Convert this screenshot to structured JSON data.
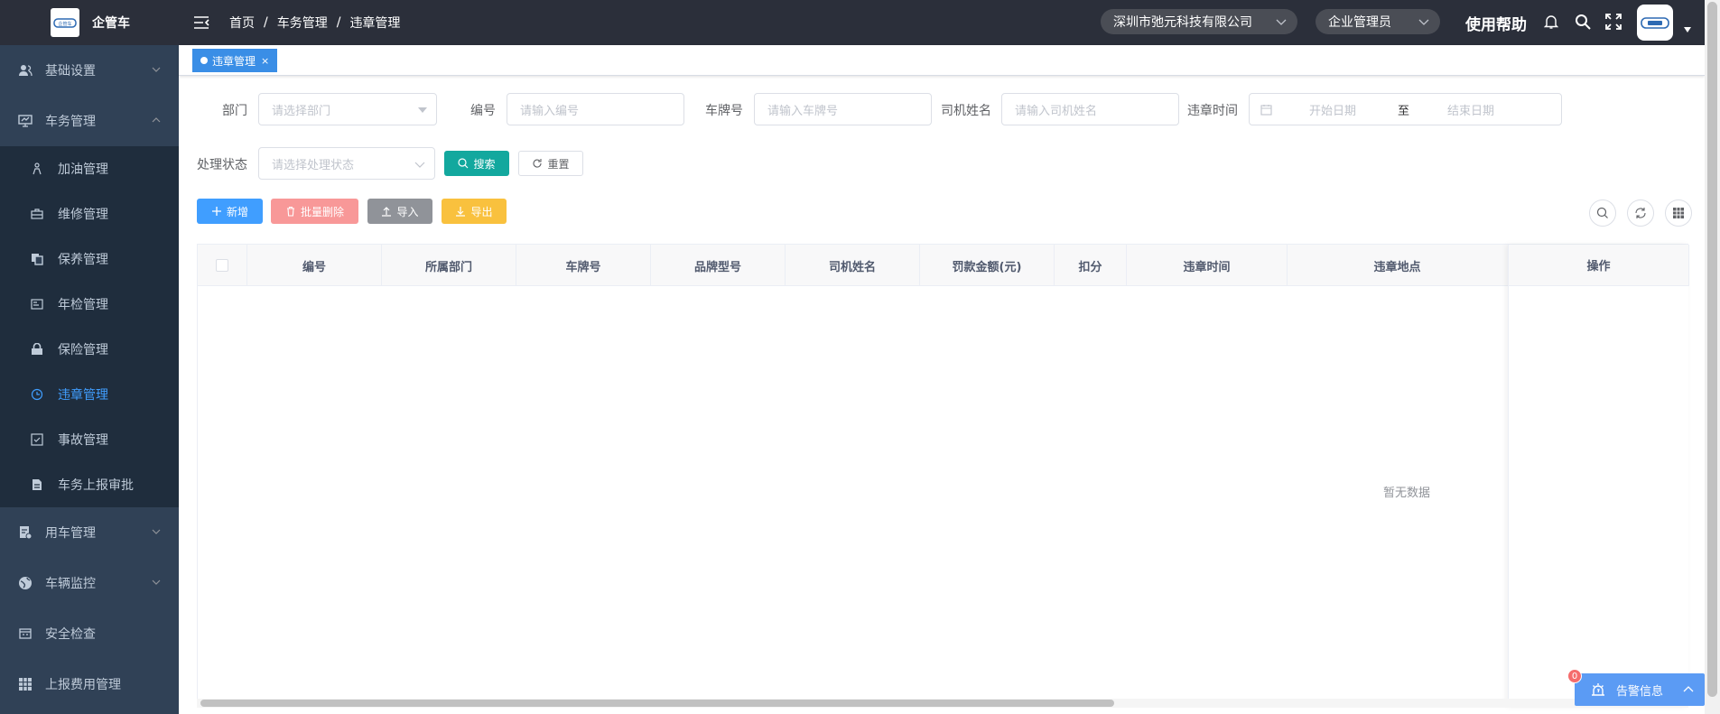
{
  "app": {
    "title": "企管车",
    "logo_text": "企管车"
  },
  "sidebar": {
    "groups": [
      {
        "label": "基础设置",
        "icon": "user-group-icon",
        "expanded": false
      },
      {
        "label": "车务管理",
        "icon": "monitor-icon",
        "expanded": true,
        "items": [
          {
            "label": "加油管理",
            "icon": "fuel-icon"
          },
          {
            "label": "维修管理",
            "icon": "toolbox-icon"
          },
          {
            "label": "保养管理",
            "icon": "copy-icon"
          },
          {
            "label": "年检管理",
            "icon": "card-icon"
          },
          {
            "label": "保险管理",
            "icon": "lock-icon"
          },
          {
            "label": "违章管理",
            "icon": "clock-icon",
            "active": true
          },
          {
            "label": "事故管理",
            "icon": "checkbox-icon"
          },
          {
            "label": "车务上报审批",
            "icon": "document-icon"
          }
        ]
      },
      {
        "label": "用车管理",
        "icon": "car-doc-icon",
        "expanded": false
      },
      {
        "label": "车辆监控",
        "icon": "globe-icon",
        "expanded": false
      },
      {
        "label": "安全检查",
        "icon": "calendar-icon"
      },
      {
        "label": "上报费用管理",
        "icon": "grid-icon"
      }
    ]
  },
  "navbar": {
    "breadcrumb": [
      "首页",
      "车务管理",
      "违章管理"
    ],
    "company": "深圳市弛元科技有限公司",
    "role": "企业管理员",
    "help": "使用帮助"
  },
  "tags": [
    {
      "label": "违章管理",
      "close": "×"
    }
  ],
  "filters": {
    "dept": {
      "label": "部门",
      "placeholder": "请选择部门"
    },
    "code": {
      "label": "编号",
      "placeholder": "请输入编号"
    },
    "plate": {
      "label": "车牌号",
      "placeholder": "请输入车牌号"
    },
    "driver": {
      "label": "司机姓名",
      "placeholder": "请输入司机姓名"
    },
    "time": {
      "label": "违章时间",
      "start_placeholder": "开始日期",
      "sep": "至",
      "end_placeholder": "结束日期"
    },
    "status": {
      "label": "处理状态",
      "placeholder": "请选择处理状态"
    },
    "search_label": "搜索",
    "reset_label": "重置"
  },
  "toolbar": {
    "add": "新增",
    "batch_delete": "批量删除",
    "import": "导入",
    "export": "导出"
  },
  "table": {
    "columns": [
      "编号",
      "所属部门",
      "车牌号",
      "品牌型号",
      "司机姓名",
      "罚款金额(元)",
      "扣分",
      "违章时间",
      "违章地点"
    ],
    "action_column": "操作",
    "empty_text": "暂无数据",
    "rows": []
  },
  "alert_widget": {
    "label": "告警信息",
    "count": "0"
  },
  "colors": {
    "sidebar_bg": "#304156",
    "navbar_bg": "#2b2f3a",
    "active": "#409eff",
    "primary": "#409eff",
    "search_btn": "#13a89e",
    "danger_light": "#f89898",
    "import_btn": "#909399",
    "export_btn": "#f9c13e"
  }
}
